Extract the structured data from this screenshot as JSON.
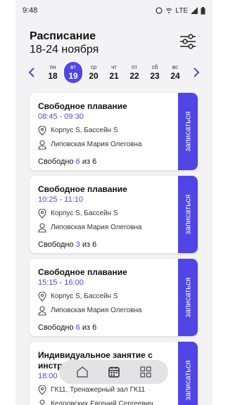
{
  "status": {
    "time": "9:48",
    "network": "LTE"
  },
  "header": {
    "title": "Расписание",
    "period": "18-24 ноября"
  },
  "week": {
    "days": [
      {
        "weekday": "пн",
        "date": "18"
      },
      {
        "weekday": "вт",
        "date": "19",
        "selected": true
      },
      {
        "weekday": "ср",
        "date": "20"
      },
      {
        "weekday": "чт",
        "date": "21"
      },
      {
        "weekday": "пт",
        "date": "22"
      },
      {
        "weekday": "сб",
        "date": "23"
      },
      {
        "weekday": "вс",
        "date": "24"
      }
    ]
  },
  "cards": [
    {
      "title": "Свободное плавание",
      "time": "08:45 - 09:30",
      "location": "Корпус S, Бассейн S",
      "trainer": "Липовская Мария Олеговна",
      "free_label": "Свободно",
      "free": "6",
      "of_label": "из 6",
      "action": "записаться"
    },
    {
      "title": "Свободное плавание",
      "time": "10:25 - 11:10",
      "location": "Корпус S, Бассейн S",
      "trainer": "Липовская Мария Олеговна",
      "free_label": "Свободно",
      "free": "3",
      "of_label": "из 6",
      "action": "записаться"
    },
    {
      "title": "Свободное плавание",
      "time": "15:15 - 16:00",
      "location": "Корпус S, Бассейн S",
      "trainer": "Липовская Мария Олеговна",
      "free_label": "Свободно",
      "free": "6",
      "of_label": "из 6",
      "action": "записаться"
    },
    {
      "title": "Индивидуальное занятие с инстр...",
      "time": "18:00",
      "location": "ГК11, Тренажерный зал ГК11",
      "trainer": "Кедровских Евгений Сергеевич",
      "action": "записаться"
    }
  ],
  "nav": [
    "home-icon",
    "calendar-icon",
    "grid-icon"
  ],
  "colors": {
    "accent": "#4f46e5",
    "background": "#f3f3f5"
  }
}
